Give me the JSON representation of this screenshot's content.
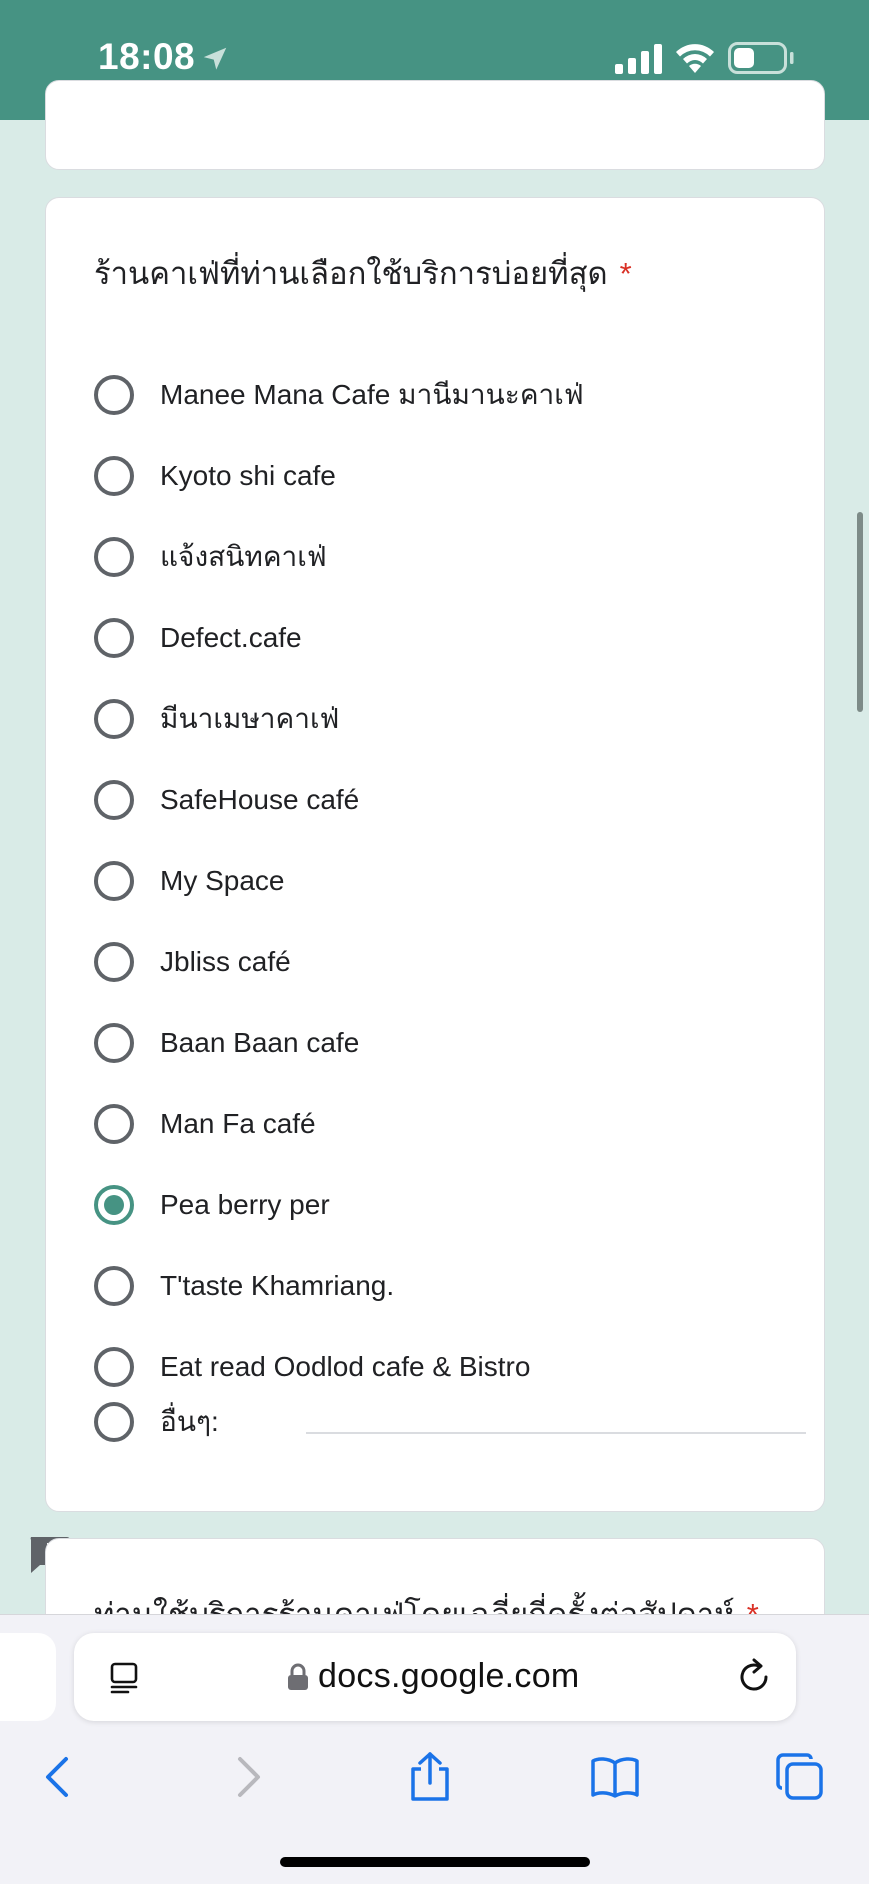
{
  "status_bar": {
    "time": "18:08",
    "location_icon": "location-arrow-icon",
    "signal_icon": "cellular-signal-icon",
    "wifi_icon": "wifi-icon",
    "battery_icon": "battery-low-icon"
  },
  "colors": {
    "theme": "#469383",
    "background": "#d9ebe7",
    "required": "#d93025",
    "safari_blue": "#1a73e8"
  },
  "question": {
    "title": "ร้านคาเฟ่ที่ท่านเลือกใช้บริการบ่อยที่สุด",
    "required_mark": "*",
    "options": [
      {
        "label": "Manee Mana Cafe มานีมานะคาเฟ่",
        "selected": false
      },
      {
        "label": "Kyoto shi cafe",
        "selected": false
      },
      {
        "label": "แจ้งสนิทคาเฟ่",
        "selected": false
      },
      {
        "label": "Defect.cafe",
        "selected": false
      },
      {
        "label": "มีนาเมษาคาเฟ่",
        "selected": false
      },
      {
        "label": "SafeHouse café",
        "selected": false
      },
      {
        "label": "My Space",
        "selected": false
      },
      {
        "label": "Jbliss café",
        "selected": false
      },
      {
        "label": "Baan Baan cafe",
        "selected": false
      },
      {
        "label": "Man Fa café",
        "selected": false
      },
      {
        "label": "Pea berry per",
        "selected": true
      },
      {
        "label": "T'taste Khamriang.",
        "selected": false
      },
      {
        "label": "Eat read Oodlod cafe & Bistro",
        "selected": false
      }
    ],
    "other_option": {
      "label": "อื่นๆ:",
      "value": "",
      "selected": false
    }
  },
  "next_question": {
    "title": "ท่านใช้บริการร้านคาเฟ่โดยเฉลี่ยกี่ครั้งต่อสัปดาห์",
    "required_mark": "*"
  },
  "feedback_icon": "report-issue-icon",
  "browser": {
    "address": "docs.google.com",
    "reader_icon": "reader-mode-icon",
    "lock_icon": "lock-icon",
    "reload_icon": "reload-icon",
    "toolbar": {
      "back": "back-chevron-icon",
      "forward": "forward-chevron-icon",
      "share": "share-icon",
      "bookmarks": "bookmarks-icon",
      "tabs": "tabs-icon"
    }
  }
}
